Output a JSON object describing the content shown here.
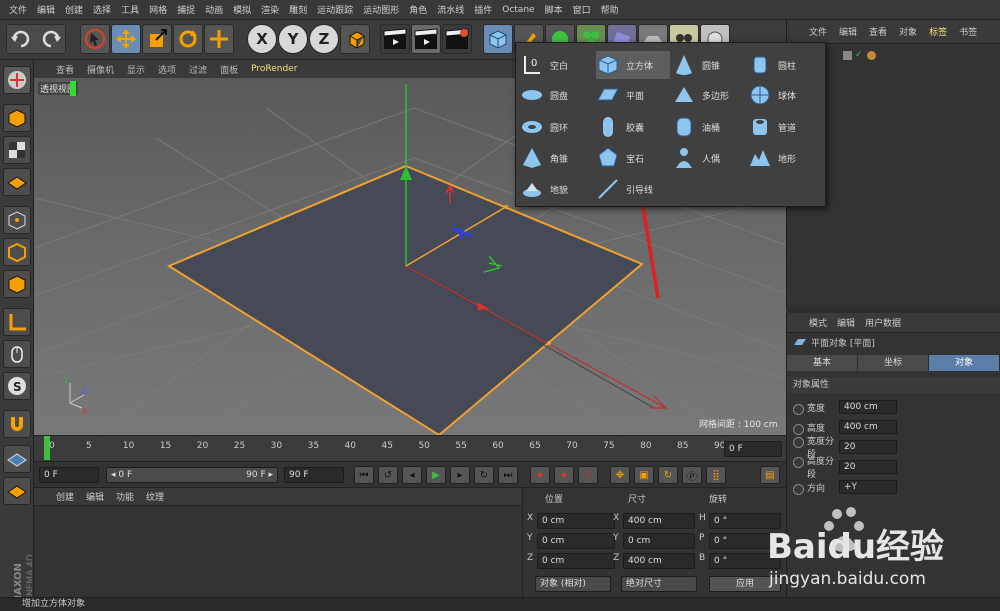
{
  "menubar": [
    "文件",
    "编辑",
    "创建",
    "选择",
    "工具",
    "网格",
    "捕捉",
    "动画",
    "模拟",
    "渲染",
    "雕刻",
    "运动跟踪",
    "运动图形",
    "角色",
    "流水线",
    "插件",
    "Octane",
    "脚本",
    "窗口",
    "帮助"
  ],
  "toolbar": {
    "x_axis": "X",
    "y_axis": "Y",
    "z_axis": "Z"
  },
  "viewport": {
    "menu": [
      "查看",
      "摄像机",
      "显示",
      "选项",
      "过滤",
      "面板",
      "ProRender"
    ],
    "highlighted_menu_index": 6,
    "view_label": "透视视图",
    "grid_spacing": "网格间距 : 100 cm",
    "axis_y": "Y",
    "axis_z": "Z",
    "axis_x": "X"
  },
  "timeline": {
    "ticks": [
      "0",
      "5",
      "10",
      "15",
      "20",
      "25",
      "30",
      "35",
      "40",
      "45",
      "50",
      "55",
      "60",
      "65",
      "70",
      "75",
      "80",
      "85",
      "90"
    ],
    "current_frame": "0 F"
  },
  "transport": {
    "start": "0 F",
    "range_start": "◂ 0 F",
    "range_end": "90 F ▸",
    "end": "90 F"
  },
  "material_panel": {
    "menu": [
      "创建",
      "编辑",
      "功能",
      "纹理"
    ]
  },
  "coord_panel": {
    "headers": [
      "位置",
      "尺寸",
      "旋转"
    ],
    "rows": [
      {
        "axis": "X",
        "pos": "0 cm",
        "size_axis": "X",
        "size": "400 cm",
        "rot_axis": "H",
        "rot": "0 °"
      },
      {
        "axis": "Y",
        "pos": "0 cm",
        "size_axis": "Y",
        "size": "0 cm",
        "rot_axis": "P",
        "rot": "0 °"
      },
      {
        "axis": "Z",
        "pos": "0 cm",
        "size_axis": "Z",
        "size": "400 cm",
        "rot_axis": "B",
        "rot": "0 °"
      }
    ],
    "mode": "对象 (相对)",
    "size_mode": "绝对尺寸",
    "apply": "应用"
  },
  "object_manager": {
    "menu": [
      "文件",
      "编辑",
      "查看",
      "对象",
      "标签",
      "书签"
    ],
    "object_name": "平面"
  },
  "attr_manager": {
    "menu": [
      "模式",
      "编辑",
      "用户数据"
    ],
    "title": "平面对象 [平面]",
    "tabs": [
      "基本",
      "坐标",
      "对象"
    ],
    "section": "对象属性",
    "rows": [
      {
        "label": "宽度",
        "value": "400 cm"
      },
      {
        "label": "高度",
        "value": "400 cm"
      },
      {
        "label": "宽度分段",
        "value": "20"
      },
      {
        "label": "高度分段",
        "value": "20"
      },
      {
        "label": "方向",
        "value": "+Y"
      }
    ]
  },
  "popup": {
    "items": [
      {
        "label": "空白",
        "icon": "null-icon"
      },
      {
        "label": "立方体",
        "icon": "cube-icon",
        "highlight": true
      },
      {
        "label": "圆锥",
        "icon": "cone-icon"
      },
      {
        "label": "圆柱",
        "icon": "cylinder-icon"
      },
      {
        "label": "圆盘",
        "icon": "disc-icon"
      },
      {
        "label": "平面",
        "icon": "plane-icon"
      },
      {
        "label": "多边形",
        "icon": "polygon-icon"
      },
      {
        "label": "球体",
        "icon": "sphere-icon"
      },
      {
        "label": "圆环",
        "icon": "torus-icon"
      },
      {
        "label": "胶囊",
        "icon": "capsule-icon"
      },
      {
        "label": "油桶",
        "icon": "oiltank-icon"
      },
      {
        "label": "管道",
        "icon": "tube-icon"
      },
      {
        "label": "角锥",
        "icon": "pyramid-icon"
      },
      {
        "label": "宝石",
        "icon": "platonic-icon"
      },
      {
        "label": "人偶",
        "icon": "figure-icon"
      },
      {
        "label": "地形",
        "icon": "landscape-icon"
      },
      {
        "label": "地貌",
        "icon": "relief-icon"
      },
      {
        "label": "引导线",
        "icon": "guide-icon"
      }
    ]
  },
  "status": "增加立方体对象",
  "brand": "MAXON CINEMA 4D",
  "watermark": {
    "text": "Baidu经验",
    "url": "jingyan.baidu.com"
  },
  "colors": {
    "accent": "#f2e27a",
    "selection": "#f0a030",
    "arrow": "#e02020"
  }
}
